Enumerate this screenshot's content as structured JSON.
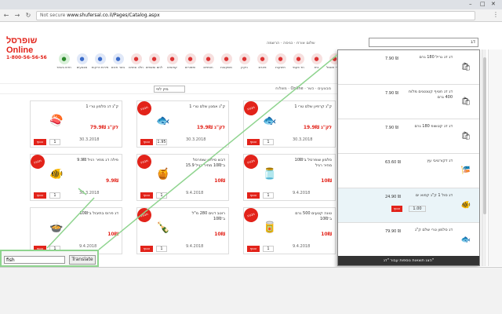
{
  "browser": {
    "window_controls": [
      "–",
      "□",
      "✕"
    ],
    "security": "Not secure",
    "url": "www.shufersal.co.il/Pages/Catalog.aspx"
  },
  "header": {
    "brand": "שופרסל Online",
    "phone": "1-800-56-56-56",
    "topmenu": "שלום אורח  ·  כניסה  ·  הרשמה",
    "search_value": "דג"
  },
  "categories": [
    "חדש באתר",
    "מבצעים",
    "פירות וירקות",
    "בשר ודגים",
    "חלב וביצים",
    "לחם ומאפים",
    "קפואים",
    "שימורים",
    "חטיפים",
    "משקאות",
    "ניקיון",
    "פארם",
    "תינוקות",
    "חד פעמי",
    "בית",
    "מוצרי חשמל"
  ],
  "filterbar": {
    "sort": "מיין לפי",
    "filters": "משלוח · Online · מבצעים · כשר"
  },
  "grid": [
    {
      "name": "1 ק\"ג\nקרפיון שלם טרי",
      "price": "19.9₪ לק\"ג",
      "date": "30.3.2018",
      "qty": "1",
      "icon": "fish-icon",
      "sale": true
    },
    {
      "name": "1 ק\"ג\nאמנון שלם טרי",
      "price": "19.9₪ לק\"ג",
      "date": "30.3.2018",
      "qty": "1.95",
      "icon": "fish-icon",
      "sale": true
    },
    {
      "name": "1 ק\"ג\nדג סלמון טרי",
      "price": "79.9₪ לק\"ג",
      "date": "30.3.2018",
      "qty": "1",
      "icon": "salmon-icon",
      "sale": false
    },
    {
      "name": "סלמון שופרסל\nב־10₪\nמחיר רגיל",
      "price": "10₪",
      "date": "9.4.2018",
      "qty": "1",
      "icon": "jar-icon",
      "sale": true
    },
    {
      "name": "דבש סילאן שופרסל\nב־10₪\nמחיר רגיל 15.9",
      "price": "10₪",
      "date": "9.4.2018",
      "qty": "1",
      "icon": "honey-icon",
      "sale": true
    },
    {
      "name": "פילה דג\nמחיר רגיל 9.9₪",
      "price": "9.9₪",
      "date": "30.3.2018",
      "qty": "1",
      "icon": "fish-fillet-icon",
      "sale": true
    },
    {
      "name": "טונה קטעים 500 גרם\nב־10₪",
      "price": "10₪",
      "date": "9.4.2018",
      "qty": "1",
      "icon": "can-icon",
      "sale": true
    },
    {
      "name": "רוטב דגים 280 מ\"ל\nב־10₪",
      "price": "10₪",
      "date": "9.4.2018",
      "qty": "1",
      "icon": "sauce-icon",
      "sale": true
    },
    {
      "name": "דג פרוס בתיבול\nב־10₪",
      "price": "10₪",
      "date": "9.4.2018",
      "qty": "1",
      "icon": "dish-icon",
      "sale": false
    }
  ],
  "panel": {
    "items": [
      {
        "name": "דג דג גריל 180 גרם",
        "price": "7.90 ₪",
        "icon": "snack-bag-icon",
        "highlight": false
      },
      {
        "name": "דג דג חטיף קטנטנים מלוח 400 גרם",
        "price": "7.90 ₪",
        "icon": "snack-bag-icon",
        "highlight": false
      },
      {
        "name": "דג דג קטשופ 180 גרם",
        "price": "7.90 ₪",
        "icon": "snack-bag-icon",
        "highlight": false
      },
      {
        "name": "דג דקורטיבי עץ",
        "price": "63.60 ₪",
        "icon": "wood-fish-icon",
        "highlight": false
      },
      {
        "name": "דג סול 1 ק\"ג קפוא ים",
        "price": "24.90 ₪",
        "icon": "fish-fillet-icon",
        "highlight": true
      },
      {
        "name": "דג סלמון טרי שלם ק\"ג",
        "price": "79.90 ₪",
        "icon": "fish-icon",
        "highlight": false
      }
    ],
    "add_label": "הוסף",
    "qty": "1.00",
    "footer": "הצג תוצאות נוספות עבור \"דג\""
  },
  "translate": {
    "input_value": "fish",
    "button": "Translate"
  },
  "colors": {
    "accent": "#e2231a",
    "highlight_row": "#eaf4f8",
    "annotation": "#8fd48f"
  }
}
